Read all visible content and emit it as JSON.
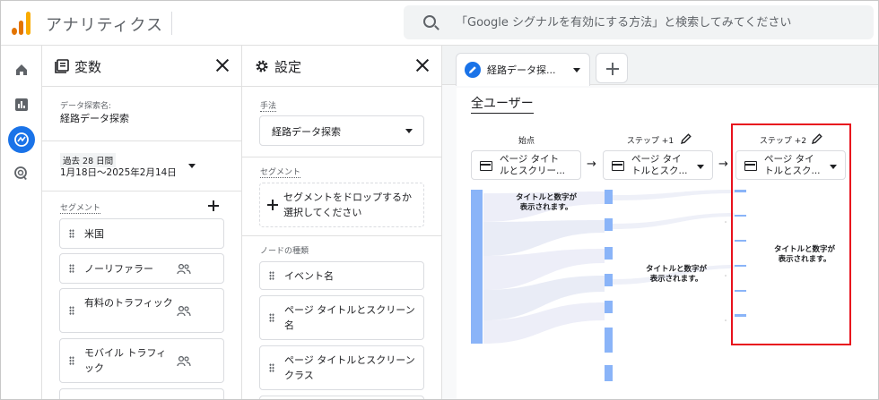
{
  "app": {
    "title": "アナリティクス",
    "logo_colors": [
      "#f9ab00",
      "#e37400",
      "#e37400"
    ]
  },
  "search": {
    "placeholder": "「Google シグナルを有効にする方法」と検索してみてください"
  },
  "rail": {
    "items": [
      {
        "name": "home-icon"
      },
      {
        "name": "reports-icon"
      },
      {
        "name": "explore-icon",
        "active": true
      },
      {
        "name": "advertising-icon"
      }
    ]
  },
  "variables_panel": {
    "title": "変数",
    "exploration_name_label": "データ探索名:",
    "exploration_name": "経路データ探索",
    "date_range_label": "過去 28 日間",
    "date_range": "1月18日～2025年2月14日",
    "segments_label": "セグメント",
    "segments": [
      {
        "label": "米国",
        "has_people_icon": false
      },
      {
        "label": "ノーリファラー",
        "has_people_icon": true
      },
      {
        "label": "有料のトラフィック",
        "has_people_icon": true
      },
      {
        "label": "モバイル トラフィック",
        "has_people_icon": true
      }
    ]
  },
  "settings_panel": {
    "title": "設定",
    "technique_label": "手法",
    "technique_value": "経路データ探索",
    "segments_label": "セグメント",
    "segment_drop_text": "セグメントをドロップするか選択してください",
    "node_types_label": "ノードの種類",
    "node_types": [
      {
        "label": "イベント名"
      },
      {
        "label": "ページ タイトルとスクリーン名"
      },
      {
        "label": "ページ タイトルとスクリーン クラス"
      }
    ]
  },
  "tabs": {
    "active_tab": "経路データ探...",
    "add_tab_label": "+"
  },
  "canvas": {
    "segment_title": "全ユーザー",
    "columns": [
      {
        "label": "始点",
        "node": "ページ タイトルとスクリーン名",
        "node_display": "ページ タイト\nルとスクリー...",
        "editable": false,
        "overlay": "タイトルと数字が\n表示されます。"
      },
      {
        "label": "ステップ +1",
        "node": "ページ タイトルとスクリーン名",
        "node_display": "ページ タイ\nトルとスク...",
        "editable": true,
        "overlay": "タイトルと数字が\n表示されます。"
      },
      {
        "label": "ステップ +2",
        "node": "ページ タイトルとスクリーン名",
        "node_display": "ページ タイ\nトルとスク...",
        "editable": true,
        "overlay": "タイトルと数字が\n表示されます。"
      }
    ],
    "highlight_color": "#e8111d",
    "bar_color": "#8ab4f8",
    "accent_color": "#1a73e8"
  }
}
